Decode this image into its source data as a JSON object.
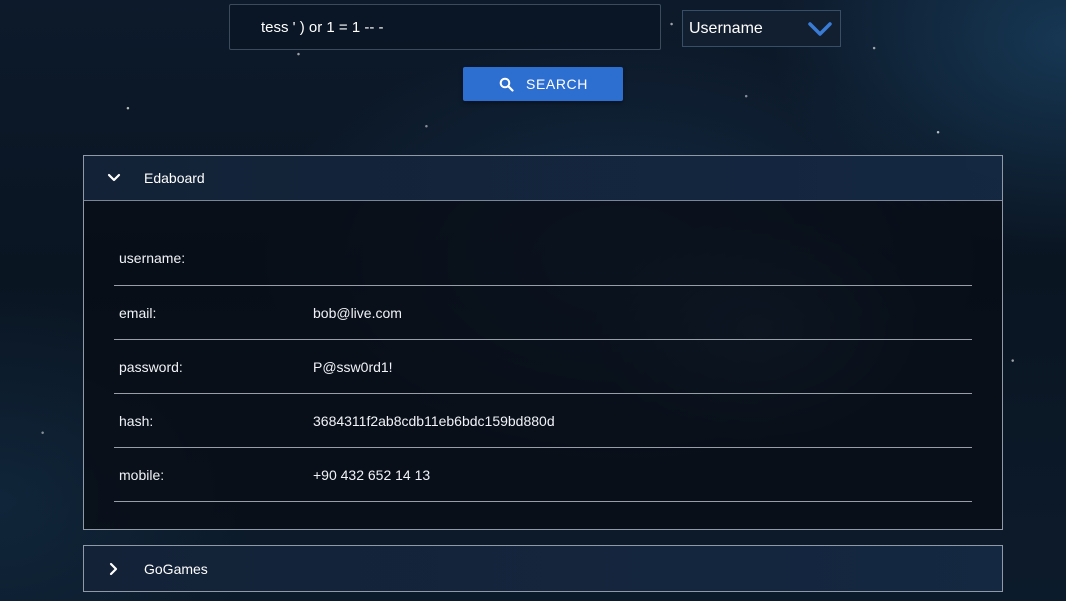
{
  "search": {
    "query": "tess ' ) or 1 = 1 -- -",
    "field_selected": "Username",
    "button_label": "SEARCH"
  },
  "results": [
    {
      "name": "Edaboard",
      "expanded": true,
      "fields": [
        {
          "key": "username:",
          "value": ""
        },
        {
          "key": "email:",
          "value": "bob@live.com"
        },
        {
          "key": "password:",
          "value": "P@ssw0rd1!"
        },
        {
          "key": "hash:",
          "value": "3684311f2ab8cdb11eb6bdc159bd880d"
        },
        {
          "key": "mobile:",
          "value": "+90 432 652 14 13"
        }
      ]
    },
    {
      "name": "GoGames",
      "expanded": false
    }
  ],
  "icons": {
    "search": "search-icon",
    "dropdown": "chevron-down-icon",
    "expanded": "chevron-down-icon",
    "collapsed": "chevron-right-icon"
  },
  "colors": {
    "accent": "#2d6fd1",
    "dropdown_chevron": "#3a7bd5"
  }
}
